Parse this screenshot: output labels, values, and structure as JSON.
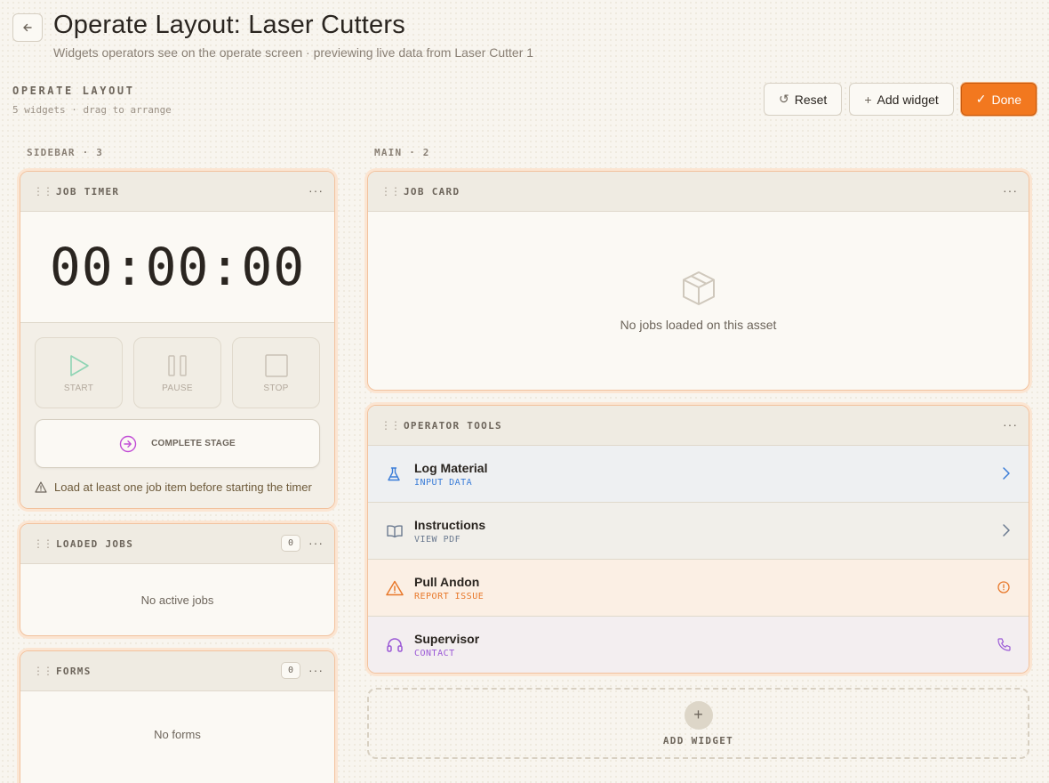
{
  "header": {
    "back_icon": "arrow-left-icon",
    "title": "Operate Layout: Laser Cutters",
    "subtitle": "Widgets operators see on the operate screen · previewing live data from Laser Cutter 1"
  },
  "section": {
    "label": "OPERATE LAYOUT",
    "sub": "5 widgets · drag to arrange"
  },
  "toolbar": {
    "reset_label": "Reset",
    "add_widget_label": "Add widget",
    "done_label": "Done",
    "accent": "#f2781f"
  },
  "columns": {
    "sidebar_label": "SIDEBAR · 3",
    "main_label": "MAIN · 2"
  },
  "job_timer": {
    "title": "JOB TIMER",
    "display": "00:00:00",
    "start_label": "START",
    "pause_label": "PAUSE",
    "stop_label": "STOP",
    "complete_label": "COMPLETE STAGE",
    "warning": "Load at least one job item before starting the timer"
  },
  "loaded_jobs": {
    "title": "LOADED JOBS",
    "count": "0",
    "empty": "No active jobs"
  },
  "forms": {
    "title": "FORMS",
    "count": "0",
    "empty": "No forms"
  },
  "job_card": {
    "title": "JOB CARD",
    "empty": "No jobs loaded on this asset",
    "icon": "box-icon"
  },
  "operator_tools": {
    "title": "OPERATOR TOOLS",
    "items": [
      {
        "name": "Log Material",
        "sub": "INPUT DATA",
        "icon": "flask-icon",
        "color": "#3b7dd8",
        "bg": "#eef0f2"
      },
      {
        "name": "Instructions",
        "sub": "VIEW PDF",
        "icon": "book-icon",
        "color": "#6b7a90",
        "bg": "#f1efea"
      },
      {
        "name": "Pull Andon",
        "sub": "REPORT ISSUE",
        "icon": "warning-icon",
        "color": "#e8782a",
        "bg": "#fbefe4"
      },
      {
        "name": "Supervisor",
        "sub": "CONTACT",
        "icon": "headset-icon",
        "color": "#9b59d6",
        "bg": "#f3eef0"
      }
    ]
  },
  "add_widget_tile": {
    "label": "ADD WIDGET"
  }
}
